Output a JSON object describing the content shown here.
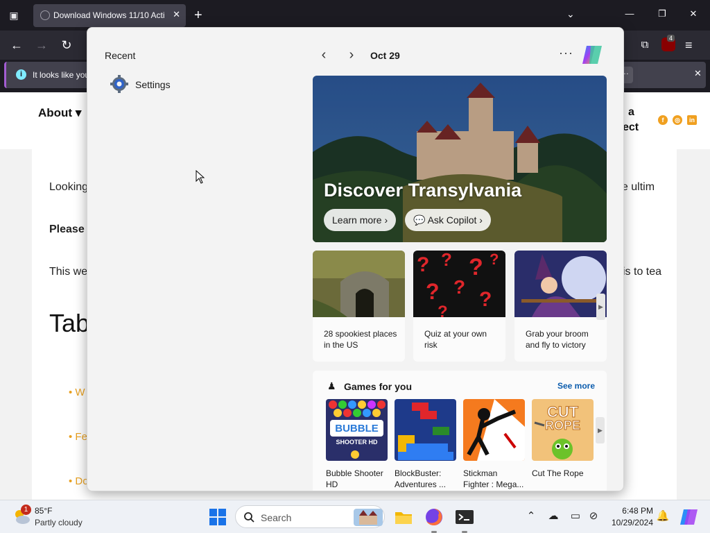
{
  "browser": {
    "tab_title": "Download Windows 11/10 Acti",
    "notification_text": "It looks like you",
    "ublock_count": "4"
  },
  "website": {
    "nav_about": "About ▾",
    "header_right_line1": "a",
    "header_right_line2": "ect",
    "paragraph1": "Looking",
    "paragraph1_right": "he ultim",
    "paragraph2": "Please",
    "paragraph3": "This we",
    "paragraph3_right": "is to tea",
    "heading": "Tab",
    "bullets": [
      "W",
      "Fe",
      "Do"
    ]
  },
  "start_menu": {
    "recent_title": "Recent",
    "recent_items": [
      {
        "label": "Settings",
        "icon": "gear-icon"
      }
    ],
    "date": "Oct 29",
    "hero": {
      "title": "Discover Transylvania",
      "learn_more": "Learn more",
      "ask_copilot": "Ask Copilot"
    },
    "cards": [
      {
        "text": "28 spookiest places in the US"
      },
      {
        "text": "Quiz at your own risk"
      },
      {
        "text": "Grab your broom and fly to victory"
      }
    ],
    "games": {
      "title": "Games for you",
      "see_more": "See more",
      "items": [
        {
          "line1": "Bubble Shooter",
          "line2": "HD"
        },
        {
          "line1": "BlockBuster:",
          "line2": "Adventures ..."
        },
        {
          "line1": "Stickman",
          "line2": "Fighter : Mega..."
        },
        {
          "line1": "Cut The Rope",
          "line2": ""
        }
      ]
    }
  },
  "taskbar": {
    "weather_temp": "85°F",
    "weather_desc": "Partly cloudy",
    "weather_badge": "1",
    "search_placeholder": "Search",
    "time": "6:48 PM",
    "date": "10/29/2024"
  }
}
